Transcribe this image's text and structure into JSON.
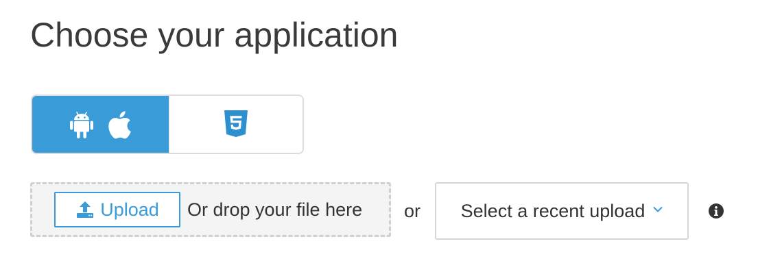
{
  "page": {
    "title": "Choose your application"
  },
  "platform_toggle": {
    "options": [
      {
        "id": "native",
        "icons": [
          "android-icon",
          "apple-icon"
        ],
        "selected": true
      },
      {
        "id": "html5",
        "icons": [
          "html5-icon"
        ],
        "selected": false
      }
    ]
  },
  "upload": {
    "button_label": "Upload",
    "button_icon": "upload-icon",
    "drop_hint": "Or drop your file here"
  },
  "separator_text": "or",
  "recent_upload": {
    "selected_label": "Select a recent upload",
    "icon": "chevron-down-icon"
  },
  "info": {
    "icon": "info-icon"
  },
  "colors": {
    "accent": "#3a9bd9",
    "title_text": "#3a3a3a",
    "body_text": "#333333",
    "dropzone_bg": "#f4f4f4",
    "border": "#dcdcdc",
    "html5_blue": "#2d8ed0"
  }
}
